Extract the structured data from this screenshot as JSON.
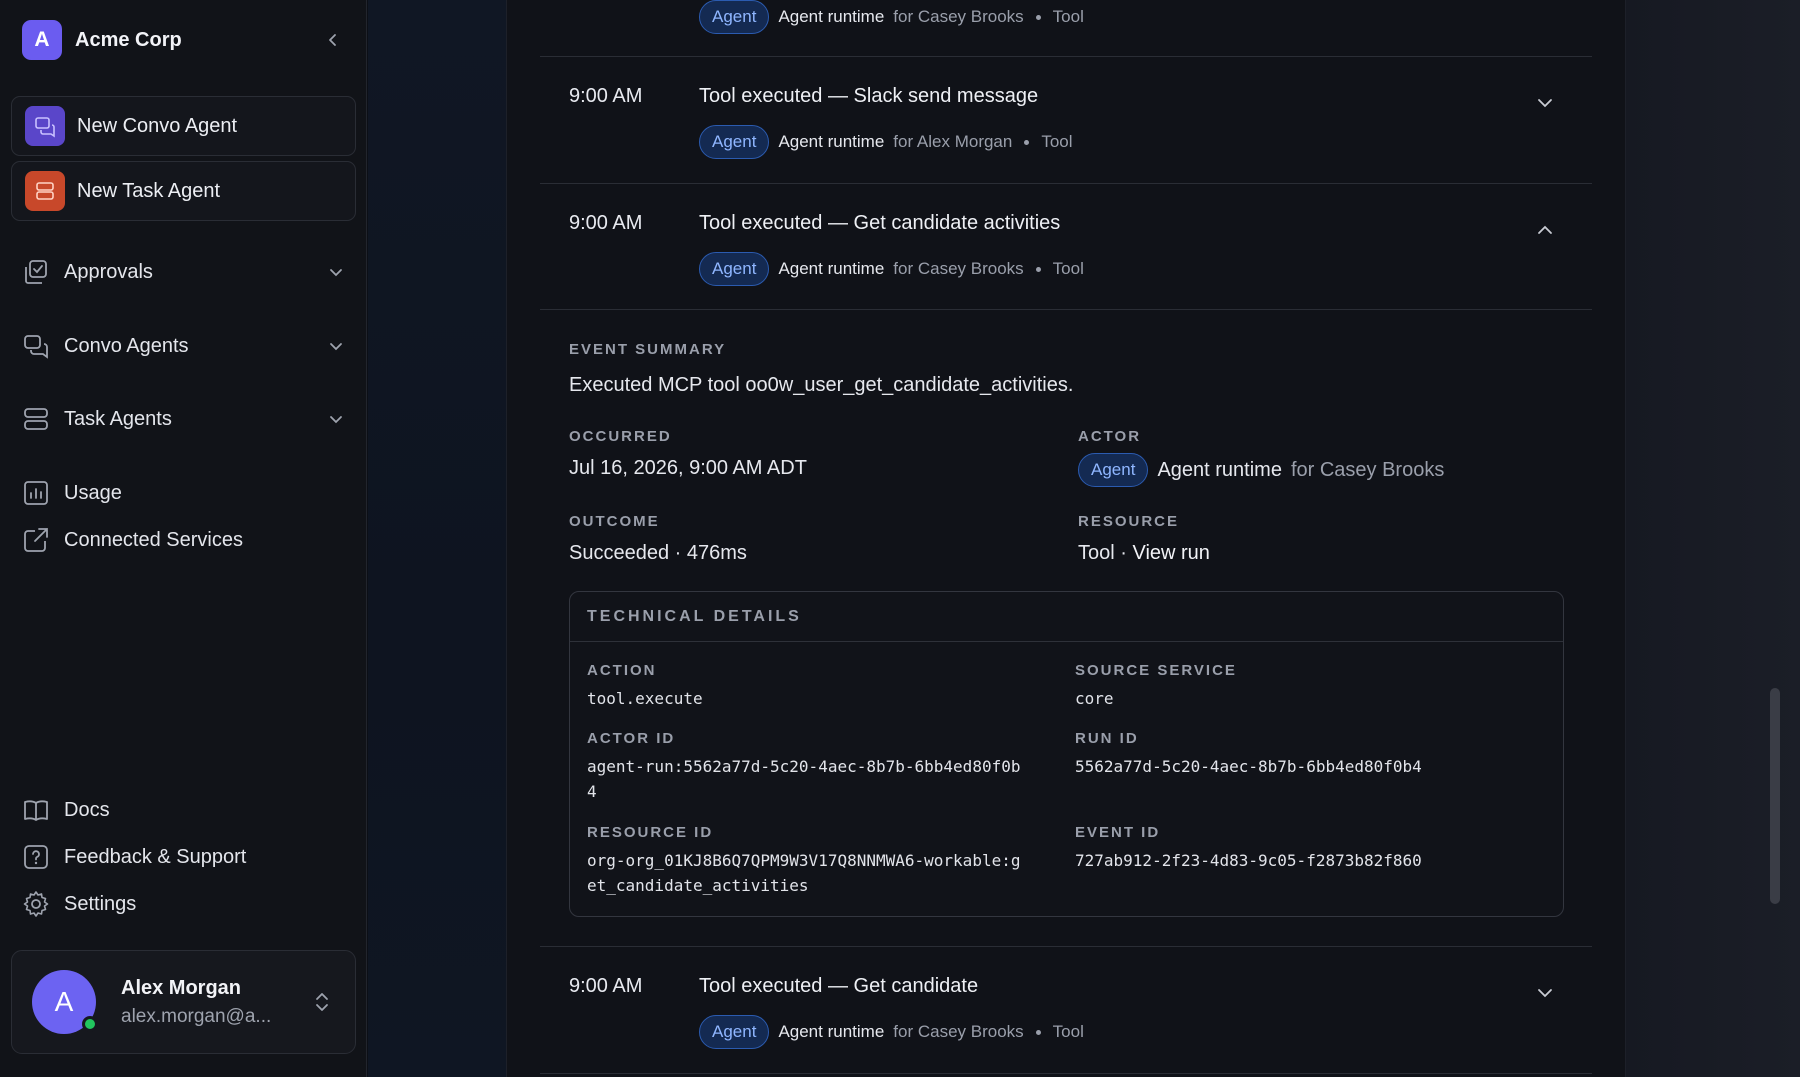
{
  "sidebar": {
    "org_initial": "A",
    "org_name": "Acme Corp",
    "new_convo_label": "New Convo Agent",
    "new_task_label": "New Task Agent",
    "nav": {
      "approvals": "Approvals",
      "convo_agents": "Convo Agents",
      "task_agents": "Task Agents",
      "usage": "Usage",
      "connected_services": "Connected Services",
      "docs": "Docs",
      "feedback": "Feedback & Support",
      "settings": "Settings"
    },
    "user": {
      "initial": "A",
      "name": "Alex Morgan",
      "email": "alex.morgan@a..."
    }
  },
  "events": [
    {
      "time": "",
      "title": "",
      "badge": "Agent",
      "actor": "Agent runtime",
      "for": "for Casey Brooks",
      "resource": "Tool"
    },
    {
      "time": "9:00 AM",
      "title": "Tool executed — Slack send message",
      "badge": "Agent",
      "actor": "Agent runtime",
      "for": "for Alex Morgan",
      "resource": "Tool"
    },
    {
      "time": "9:00 AM",
      "title": "Tool executed — Get candidate activities",
      "badge": "Agent",
      "actor": "Agent runtime",
      "for": "for Casey Brooks",
      "resource": "Tool"
    },
    {
      "time": "9:00 AM",
      "title": "Tool executed — Get candidate",
      "badge": "Agent",
      "actor": "Agent runtime",
      "for": "for Casey Brooks",
      "resource": "Tool"
    }
  ],
  "detail": {
    "summary_label": "EVENT SUMMARY",
    "summary_text": "Executed MCP tool oo0w_user_get_candidate_activities.",
    "occurred_label": "OCCURRED",
    "occurred_value": "Jul 16, 2026, 9:00 AM ADT",
    "actor_label": "ACTOR",
    "actor_badge": "Agent",
    "actor_name": "Agent runtime",
    "actor_for": "for Casey Brooks",
    "outcome_label": "OUTCOME",
    "outcome_value": "Succeeded · 476ms",
    "resource_label": "RESOURCE",
    "resource_value": "Tool · ",
    "view_run": "View run",
    "technical": {
      "heading": "TECHNICAL DETAILS",
      "action_label": "ACTION",
      "action_value": "tool.execute",
      "source_label": "SOURCE SERVICE",
      "source_value": "core",
      "actor_id_label": "ACTOR ID",
      "actor_id_line1": "agent-run:5562a77d-5c20-4aec-8b7b-6bb4ed80f0b",
      "actor_id_line2": "4",
      "run_id_label": "RUN ID",
      "run_id_value": "5562a77d-5c20-4aec-8b7b-6bb4ed80f0b4",
      "resource_id_label": "RESOURCE ID",
      "resource_id_line1": "org-org_01KJ8B6Q7QPM9W3V17Q8NNMWA6-workable:g",
      "resource_id_line2": "et_candidate_activities",
      "event_id_label": "EVENT ID",
      "event_id_value": "727ab912-2f23-4d83-9c05-f2873b82f860"
    }
  },
  "colors": {
    "accent": "#6b5cf0",
    "badge_bg": "#142a52",
    "badge_text": "#8fb6ff",
    "online": "#22c55e",
    "task_icon_bg": "#e0512f"
  }
}
